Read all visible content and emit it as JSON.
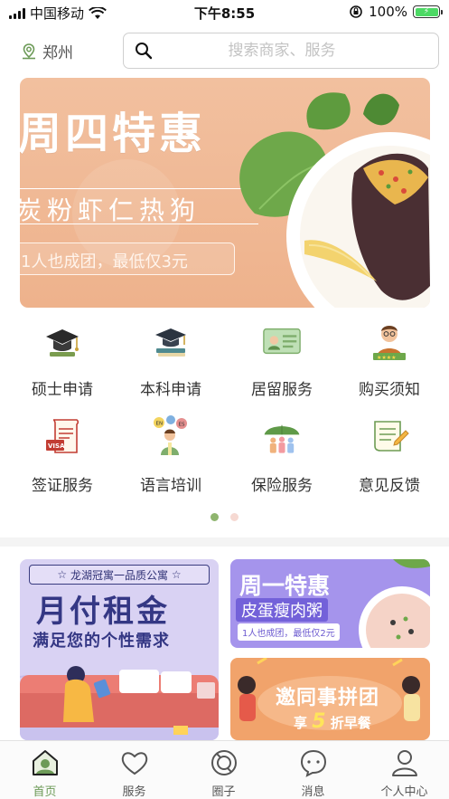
{
  "status_bar": {
    "carrier": "中国移动",
    "time": "下午8:55",
    "battery": "100%"
  },
  "header": {
    "city": "郑州",
    "search_placeholder": "搜索商家、服务"
  },
  "banner": {
    "title": "周四特惠",
    "subtitle": "炭粉虾仁热狗",
    "tag": "1人也成团，最低仅3元"
  },
  "grid": {
    "items": [
      {
        "label": "硕士申请",
        "icon": "graduation-cap-icon"
      },
      {
        "label": "本科申请",
        "icon": "mortarboard-book-icon"
      },
      {
        "label": "居留服务",
        "icon": "residence-card-icon"
      },
      {
        "label": "购买须知",
        "icon": "notice-person-icon"
      },
      {
        "label": "签证服务",
        "icon": "visa-scroll-icon"
      },
      {
        "label": "语言培训",
        "icon": "language-speaker-icon"
      },
      {
        "label": "保险服务",
        "icon": "umbrella-family-icon"
      },
      {
        "label": "意见反馈",
        "icon": "feedback-note-icon"
      }
    ]
  },
  "pager": {
    "active_index": 0,
    "count": 2,
    "active_color": "#8fb56f",
    "inactive_color": "#f6d9d2"
  },
  "promos": {
    "left": {
      "top": "龙湖冠寓一品质公寓",
      "title": "月付租金",
      "subtitle": "满足您的个性需求"
    },
    "mid": {
      "title": "周一特惠",
      "subtitle": "皮蛋瘦肉粥",
      "tag": "1人也成团，最低仅2元"
    },
    "bottom": {
      "title": "邀同事拼团",
      "sub_prefix": "享",
      "sub_number": "5",
      "sub_suffix": "折早餐"
    }
  },
  "tabbar": {
    "tabs": [
      {
        "label": "首页",
        "icon": "home-icon",
        "active": true
      },
      {
        "label": "服务",
        "icon": "heart-icon",
        "active": false
      },
      {
        "label": "圈子",
        "icon": "circle-icon",
        "active": false
      },
      {
        "label": "消息",
        "icon": "message-icon",
        "active": false
      },
      {
        "label": "个人中心",
        "icon": "person-icon",
        "active": false
      }
    ]
  },
  "colors": {
    "accent_green": "#6c9a57",
    "banner_peach": "#f2c09f",
    "promo_purple": "#a594ec",
    "promo_orange": "#f1a36b"
  }
}
